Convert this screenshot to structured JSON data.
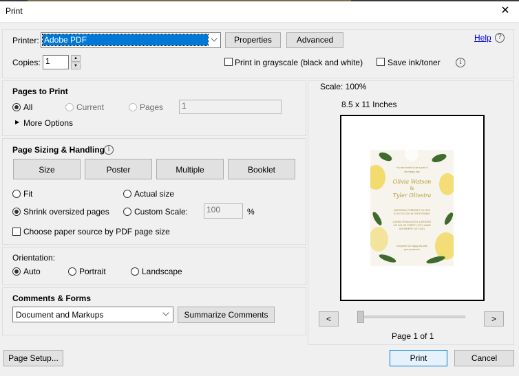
{
  "window": {
    "title": "Print",
    "close_glyph": "✕"
  },
  "top": {
    "printer_label": "Printer:",
    "printer_value": "Adobe PDF",
    "properties_label": "Properties",
    "advanced_label": "Advanced",
    "help_label": "Help",
    "help_icon_glyph": "?",
    "copies_label": "Copies:",
    "copies_value": "1",
    "grayscale_label": "Print in grayscale (black and white)",
    "save_ink_label": "Save ink/toner",
    "info_glyph": "i"
  },
  "pages_to_print": {
    "heading": "Pages to Print",
    "all_label": "All",
    "current_label": "Current",
    "pages_label": "Pages",
    "pages_value": "1",
    "more_options_label": "More Options"
  },
  "page_sizing": {
    "heading": "Page Sizing & Handling",
    "size_label": "Size",
    "poster_label": "Poster",
    "multiple_label": "Multiple",
    "booklet_label": "Booklet",
    "fit_label": "Fit",
    "actual_size_label": "Actual size",
    "shrink_label": "Shrink oversized pages",
    "custom_scale_label": "Custom Scale:",
    "custom_scale_value": "100",
    "percent_sign": "%",
    "paper_source_label": "Choose paper source by PDF page size"
  },
  "orientation": {
    "heading": "Orientation:",
    "auto_label": "Auto",
    "portrait_label": "Portrait",
    "landscape_label": "Landscape"
  },
  "comments_forms": {
    "heading": "Comments & Forms",
    "select_value": "Document and Markups",
    "summarize_label": "Summarize Comments"
  },
  "preview": {
    "scale_label": "Scale: 100%",
    "paper_size_label": "8.5 x 11 Inches",
    "prev_glyph": "<",
    "next_glyph": ">",
    "page_indicator": "Page 1 of 1",
    "card": {
      "line1": "You are invited to be a part of",
      "line2": "the happy day",
      "name1": "Olivia Watson",
      "amp": "&",
      "name2": "Tyler Oliveira",
      "date": "SATURDAY, FEBRUARY 01 2025",
      "time": "AT 6 O'CLOCK IN THE EVENING",
      "venue1": "LOREM IPSUM HOTEL & RESORT",
      "venue2": "123 DOLOR STREET, CITY NAME",
      "venue3": "ANYWHERE, NY 11201",
      "closing1": "Complete our happy day with",
      "closing2": "your presence!"
    }
  },
  "footer": {
    "page_setup_label": "Page Setup...",
    "print_label": "Print",
    "cancel_label": "Cancel"
  },
  "colors": {
    "selection": "#0078d7",
    "gold": "#b39a2c",
    "leaf": "#3f6b2f",
    "flower": "#f1d75a"
  }
}
